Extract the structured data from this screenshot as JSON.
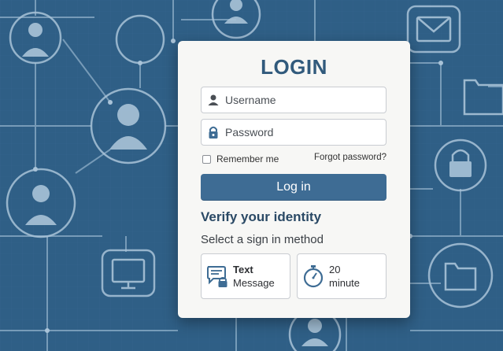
{
  "login": {
    "title": "LOGIN",
    "username_placeholder": "Username",
    "password_placeholder": "Password",
    "remember_label": "Remember me",
    "forgot_label": "Forgot password?",
    "login_button": "Log in"
  },
  "verify": {
    "heading": "Verify your identity",
    "select_label": "Select a sign in method",
    "methods": [
      {
        "line1": "Text",
        "line2": "Message",
        "icon": "chat-lock-icon"
      },
      {
        "line1": "20",
        "line2": "minute",
        "icon": "stopwatch-icon"
      }
    ]
  },
  "colors": {
    "background": "#2f5f86",
    "accent": "#3e6c94",
    "title": "#315a7c",
    "heading": "#2a4965"
  },
  "background_icons": [
    "person-icon",
    "envelope-icon",
    "folder-icon",
    "padlock-icon",
    "monitor-icon"
  ]
}
